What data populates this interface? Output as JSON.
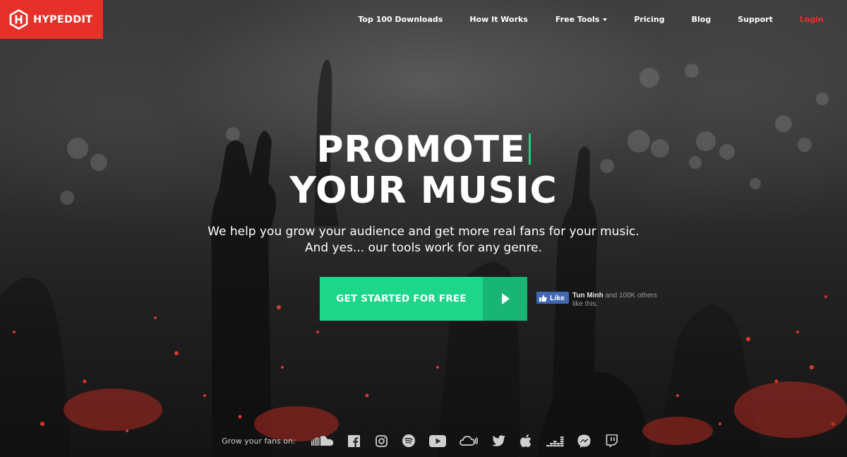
{
  "brand": {
    "name": "HYPEDDIT",
    "color": "#e5312a"
  },
  "nav": {
    "items": [
      {
        "label": "Top 100 Downloads"
      },
      {
        "label": "How It Works"
      },
      {
        "label": "Free Tools"
      },
      {
        "label": "Pricing"
      },
      {
        "label": "Blog"
      },
      {
        "label": "Support"
      },
      {
        "label": "Login"
      }
    ]
  },
  "hero": {
    "title_line1": "PROMOTE",
    "title_line2": "YOUR MUSIC",
    "subtitle_line1": "We help you grow your audience and get more real fans for your music.",
    "subtitle_line2": "And yes... our tools work for any genre.",
    "cta_label": "GET STARTED FOR FREE",
    "cta_color": "#1ed68a",
    "cta_arrow_color": "#18b574",
    "accent_color": "#1fcd84"
  },
  "facebook": {
    "like_label": "Like",
    "name": "Tun Minh",
    "suffix": " and 100K others like this."
  },
  "social": {
    "label": "Grow your fans on:",
    "platforms": [
      "soundcloud-icon",
      "facebook-icon",
      "instagram-icon",
      "spotify-icon",
      "youtube-icon",
      "mixcloud-icon",
      "twitter-icon",
      "apple-icon",
      "deezer-icon",
      "messenger-icon",
      "twitch-icon"
    ]
  }
}
